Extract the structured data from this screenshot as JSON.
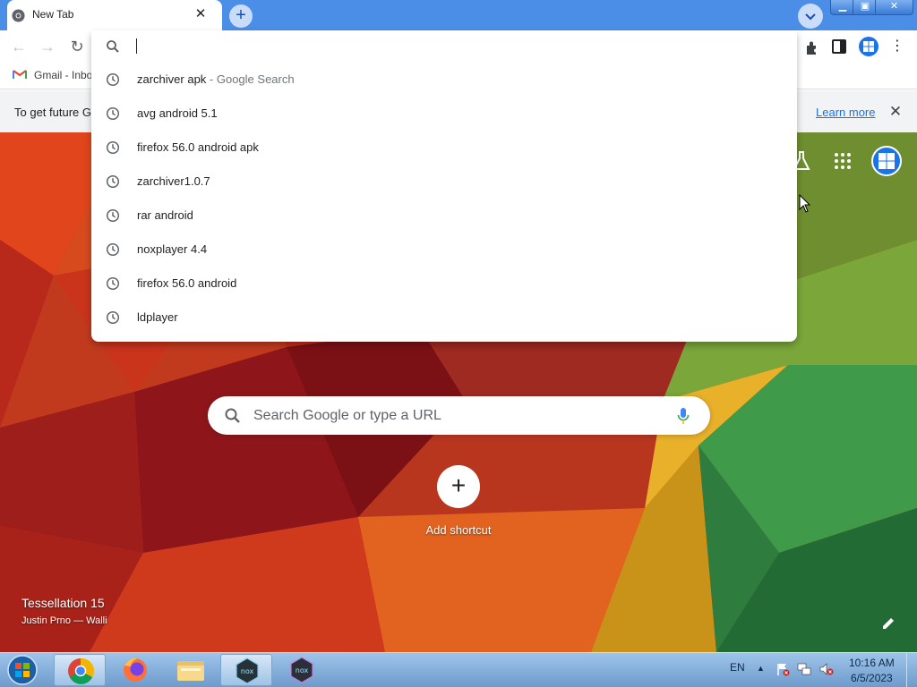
{
  "browser": {
    "tab_title": "New Tab",
    "tab_close": "✕",
    "new_tab": "+",
    "window_buttons": {
      "minimize": "▁",
      "maximize": "▣",
      "close": "✕"
    },
    "menu": "⋮"
  },
  "toolbar": {
    "back": "←",
    "forward": "→",
    "reload": "↻"
  },
  "bookmarks": [
    {
      "label": "Gmail - Inbo",
      "icon": "gmail-icon"
    }
  ],
  "infobar": {
    "text": "To get future G",
    "link": "Learn more",
    "close": "✕"
  },
  "omnibox": {
    "value": "",
    "suggestions": [
      {
        "text": "zarchiver apk",
        "description": " - Google Search",
        "icon": "history-icon"
      },
      {
        "text": "avg android 5.1",
        "icon": "history-icon"
      },
      {
        "text": "firefox 56.0 android apk",
        "icon": "history-icon"
      },
      {
        "text": "zarchiver1.0.7",
        "icon": "history-icon"
      },
      {
        "text": "rar android",
        "icon": "history-icon"
      },
      {
        "text": "noxplayer 4.4",
        "icon": "history-icon"
      },
      {
        "text": "firefox 56.0 android",
        "icon": "history-icon"
      },
      {
        "text": "ldplayer",
        "icon": "history-icon"
      }
    ]
  },
  "ntp": {
    "search_placeholder": "Search Google or type a URL",
    "add_shortcut_icon": "+",
    "add_shortcut_label": "Add shortcut",
    "background_title": "Tessellation 15",
    "background_credit": "Justin Prno — Walli"
  },
  "taskbar": {
    "apps": [
      "chrome-icon",
      "firefox-icon",
      "explorer-icon",
      "nox-icon",
      "nox-icon"
    ],
    "language": "EN",
    "tray_arrow": "▲",
    "time": "10:16 AM",
    "date": "6/5/2023"
  },
  "colors": {
    "titlebar": "#4a8ee8",
    "accent": "#1a73e8",
    "link": "#1a73e8"
  }
}
